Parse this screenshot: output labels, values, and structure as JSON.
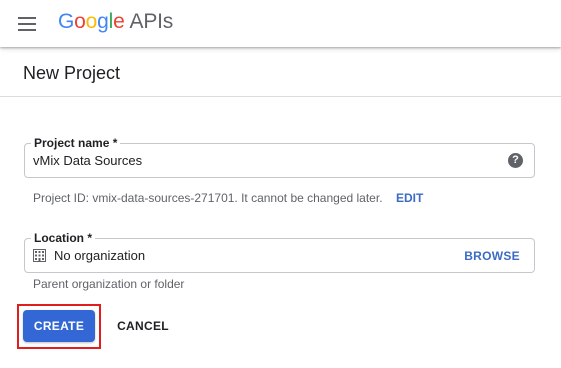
{
  "topbar": {
    "logo_letters": [
      "G",
      "o",
      "o",
      "g",
      "l",
      "e"
    ],
    "logo_suffix": "APIs",
    "menu_icon": "hamburger-menu-icon"
  },
  "page": {
    "title": "New Project"
  },
  "project_name": {
    "label": "Project name *",
    "value": "vMix Data Sources",
    "help_icon": "help-circle-icon",
    "help_glyph": "?"
  },
  "project_id": {
    "hint": "Project ID: vmix-data-sources-271701. It cannot be changed later.",
    "edit_label": "EDIT"
  },
  "location": {
    "label": "Location *",
    "value": "No organization",
    "icon": "organization-building-icon",
    "browse_label": "BROWSE",
    "hint": "Parent organization or folder"
  },
  "actions": {
    "create_label": "CREATE",
    "cancel_label": "CANCEL"
  },
  "colors": {
    "primary_button": "#3367d6",
    "highlight_border": "#e01e1e",
    "link": "#3c6bc5"
  }
}
